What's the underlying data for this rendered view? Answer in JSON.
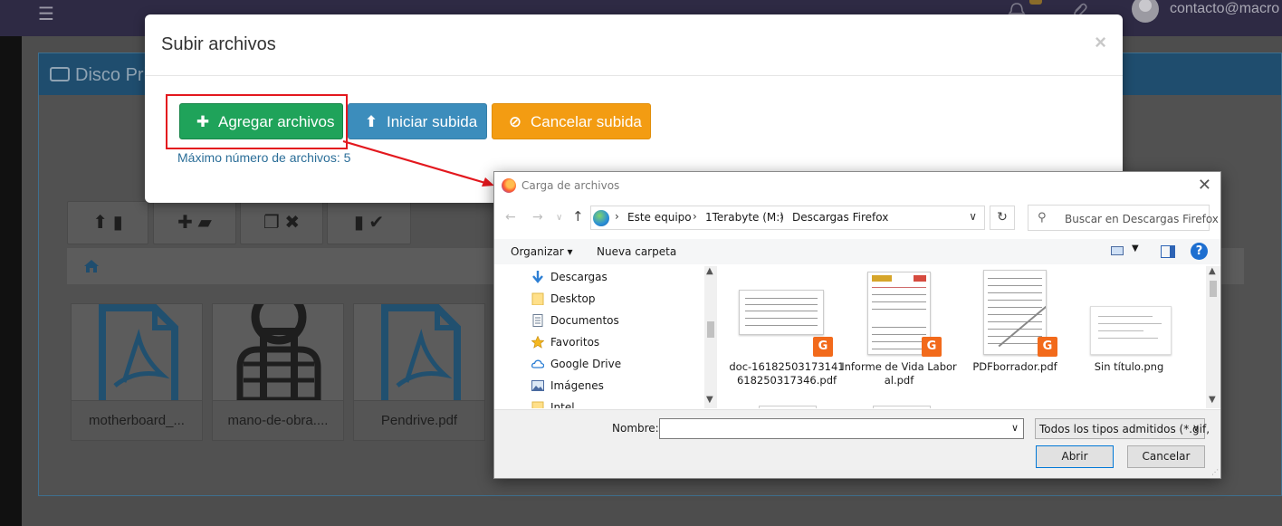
{
  "app": {
    "user_email": "contacto@macro",
    "panel_title": "Disco Pri",
    "files": [
      {
        "name": "motherboard_...",
        "icon": "pdf-icon"
      },
      {
        "name": "mano-de-obra....",
        "icon": "fist-icon"
      },
      {
        "name": "Pendrive.pdf",
        "icon": "pdf-icon"
      }
    ]
  },
  "modal": {
    "title": "Subir archivos",
    "close": "×",
    "add_label": "Agregar archivos",
    "start_label": "Iniciar subida",
    "cancel_label": "Cancelar subida",
    "max_files": "Máximo número de archivos: 5"
  },
  "dialog": {
    "title": "Carga de archivos",
    "close": "✕",
    "address": [
      "Este equipo",
      "1Terabyte (M:)",
      "Descargas Firefox"
    ],
    "search_placeholder": "Buscar en Descargas Firefox",
    "organize": "Organizar ▾",
    "new_folder": "Nueva carpeta",
    "tree": [
      {
        "label": "Descargas",
        "icon": "download-arrow-icon"
      },
      {
        "label": "Desktop",
        "icon": "folder-icon"
      },
      {
        "label": "Documentos",
        "icon": "documents-icon"
      },
      {
        "label": "Favoritos",
        "icon": "star-icon"
      },
      {
        "label": "Google Drive",
        "icon": "cloud-icon"
      },
      {
        "label": "Imágenes",
        "icon": "pictures-icon"
      },
      {
        "label": "Intel",
        "icon": "folder-icon"
      }
    ],
    "files": [
      {
        "label": "doc-16182503173141618250317346.pdf"
      },
      {
        "label": "Informe de Vida Laboral.pdf"
      },
      {
        "label": "PDFborrador.pdf"
      },
      {
        "label": "Sin título.png"
      }
    ],
    "name_label": "Nombre:",
    "name_value": "",
    "filter": "Todos los tipos admitidos (*.gif,",
    "open_label": "Abrir",
    "cancel_label": "Cancelar"
  },
  "colors": {
    "green": "#1fa35a",
    "blue": "#3c8dbc",
    "orange": "#f39c12",
    "highlight_red": "#e3181e"
  }
}
